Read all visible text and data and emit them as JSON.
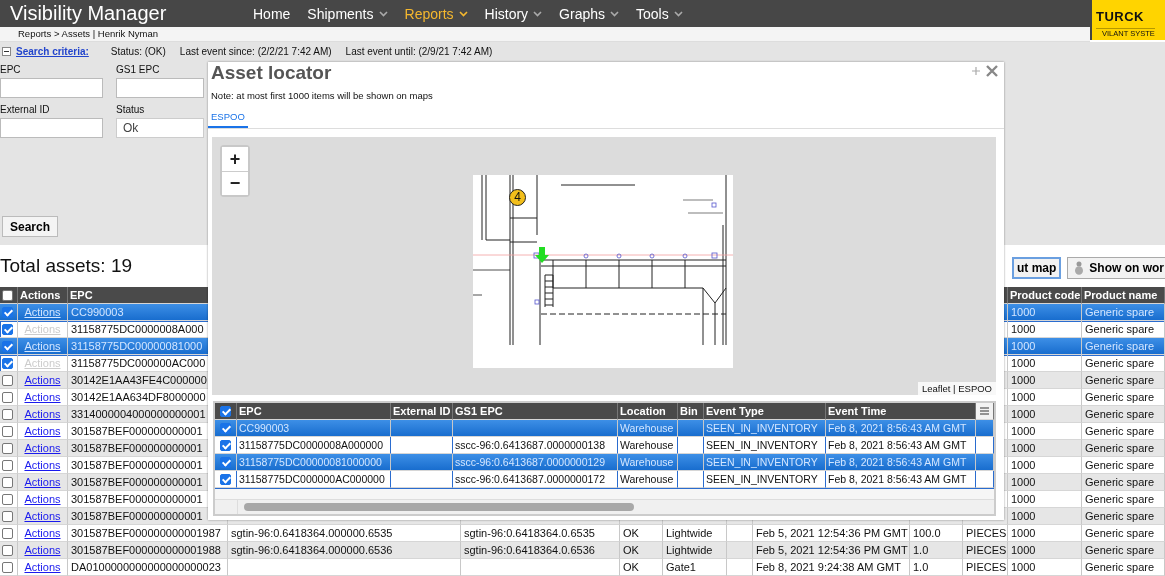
{
  "header": {
    "title": "Visibility Manager",
    "nav": [
      {
        "label": "Home",
        "selected": false,
        "has_menu": false
      },
      {
        "label": "Shipments",
        "selected": false,
        "has_menu": true
      },
      {
        "label": "Reports",
        "selected": true,
        "has_menu": true
      },
      {
        "label": "History",
        "selected": false,
        "has_menu": true
      },
      {
        "label": "Graphs",
        "selected": false,
        "has_menu": true
      },
      {
        "label": "Tools",
        "selected": false,
        "has_menu": true
      }
    ],
    "logo": {
      "brand": "TURCK",
      "tagline": "VILANT SYSTE"
    },
    "breadcrumb": "Reports > Assets | Henrik Nyman"
  },
  "search": {
    "toggle": "Search criteria:",
    "expanded": true,
    "summary": [
      "Status: (OK)",
      "Last event since: (2/2/21 7:42 AM)",
      "Last event until: (2/9/21 7:42 AM)"
    ],
    "fields": [
      {
        "label": "EPC",
        "kind": "text"
      },
      {
        "label": "GS1 EPC",
        "kind": "text"
      },
      {
        "label": "External ID",
        "kind": "text"
      },
      {
        "label": "Status",
        "kind": "select",
        "value": "Ok"
      }
    ],
    "button": "Search"
  },
  "results": {
    "total": "Total assets: 19",
    "buttons": [
      {
        "label": "ut map",
        "kind": "map"
      },
      {
        "label": "Show on wor",
        "kind": "world"
      }
    ],
    "table": {
      "header_checked": false,
      "columns": [
        "Actions",
        "EPC",
        "Product code",
        "Product name"
      ],
      "rows": [
        {
          "checked": true,
          "selected": true,
          "actions": "Actions",
          "actions_disabled": false,
          "epc": "CC990003",
          "product_code": "1000",
          "product_name": "Generic spare"
        },
        {
          "checked": true,
          "selected": false,
          "actions": "Actions",
          "actions_disabled": true,
          "epc": "31158775DC0000008A000",
          "product_code": "1000",
          "product_name": "Generic spare"
        },
        {
          "checked": true,
          "selected": true,
          "actions": "Actions",
          "actions_disabled": false,
          "epc": "31158775DC00000081000",
          "product_code": "1000",
          "product_name": "Generic spare"
        },
        {
          "checked": true,
          "selected": false,
          "actions": "Actions",
          "actions_disabled": true,
          "epc": "31158775DC000000AC000",
          "product_code": "1000",
          "product_name": "Generic spare"
        },
        {
          "checked": false,
          "selected": false,
          "actions": "Actions",
          "actions_disabled": false,
          "epc": "30142E1AA43FE4C000000",
          "product_code": "1000",
          "product_name": "Generic spare"
        },
        {
          "checked": false,
          "selected": false,
          "actions": "Actions",
          "actions_disabled": false,
          "epc": "30142E1AA634DF8000000",
          "product_code": "1000",
          "product_name": "Generic spare"
        },
        {
          "checked": false,
          "selected": false,
          "actions": "Actions",
          "actions_disabled": false,
          "epc": "3314000004000000000001",
          "product_code": "1000",
          "product_name": "Generic spare"
        },
        {
          "checked": false,
          "selected": false,
          "actions": "Actions",
          "actions_disabled": false,
          "epc": "301587BEF000000000001",
          "product_code": "1000",
          "product_name": "Generic spare"
        },
        {
          "checked": false,
          "selected": false,
          "actions": "Actions",
          "actions_disabled": false,
          "epc": "301587BEF000000000001",
          "product_code": "1000",
          "product_name": "Generic spare"
        },
        {
          "checked": false,
          "selected": false,
          "actions": "Actions",
          "actions_disabled": false,
          "epc": "301587BEF000000000001",
          "product_code": "1000",
          "product_name": "Generic spare"
        },
        {
          "checked": false,
          "selected": false,
          "actions": "Actions",
          "actions_disabled": false,
          "epc": "301587BEF000000000001",
          "product_code": "1000",
          "product_name": "Generic spare"
        },
        {
          "checked": false,
          "selected": false,
          "actions": "Actions",
          "actions_disabled": false,
          "epc": "301587BEF000000000001",
          "product_code": "1000",
          "product_name": "Generic spare"
        },
        {
          "checked": false,
          "selected": false,
          "actions": "Actions",
          "actions_disabled": false,
          "epc": "301587BEF000000000001",
          "product_code": "1000",
          "product_name": "Generic spare"
        },
        {
          "checked": false,
          "selected": false,
          "actions": "Actions",
          "actions_disabled": false,
          "epc": "301587BEF000000000001987",
          "column_4": "sgtin-96:0.6418364.000000.6535",
          "column_5": "sgtin-96:0.6418364.0.6535",
          "column_6": "OK",
          "column_7": "Lightwide",
          "column_9": "Feb 5, 2021 12:54:36 PM GMT",
          "column_10": "100.0",
          "column_11": "PIECES",
          "product_code": "1000",
          "product_name": "Generic spare"
        },
        {
          "checked": false,
          "selected": false,
          "actions": "Actions",
          "actions_disabled": false,
          "epc": "301587BEF000000000001988",
          "column_4": "sgtin-96:0.6418364.000000.6536",
          "column_5": "sgtin-96:0.6418364.0.6536",
          "column_6": "OK",
          "column_7": "Lightwide",
          "column_9": "Feb 5, 2021 12:54:36 PM GMT",
          "column_10": "1.0",
          "column_11": "PIECES",
          "product_code": "1000",
          "product_name": "Generic spare"
        },
        {
          "checked": false,
          "selected": false,
          "actions": "Actions",
          "actions_disabled": false,
          "epc": "DA0100000000000000000023",
          "column_6": "OK",
          "column_7": "Gate1",
          "column_9": "Feb 8, 2021 9:24:38 AM GMT",
          "column_10": "1.0",
          "column_11": "PIECES",
          "product_code": "1000",
          "product_name": "Generic spare"
        }
      ]
    }
  },
  "asset_locator": {
    "title": "Asset locator",
    "note": "Note: at most first 1000 items will be shown on maps",
    "tabs": [
      {
        "label": "ESPOO",
        "selected": true
      }
    ],
    "map": {
      "zoom_in": "+",
      "zoom_out": "−",
      "cluster": "4",
      "attribution": "Leaflet | ESPOO"
    },
    "table": {
      "header_checked": true,
      "columns": [
        "EPC",
        "External ID",
        "GS1 EPC",
        "Location",
        "Bin",
        "Event Type",
        "Event Time"
      ],
      "rows": [
        {
          "checked": true,
          "selected": true,
          "epc": "CC990003",
          "location": "Warehouse",
          "event_type": "SEEN_IN_INVENTORY",
          "event_time": "Feb 8, 2021 8:56:43 AM GMT"
        },
        {
          "checked": true,
          "selected": false,
          "epc": "31158775DC0000008A000000",
          "gs1_epc": "sscc-96:0.6413687.0000000138",
          "location": "Warehouse",
          "event_type": "SEEN_IN_INVENTORY",
          "event_time": "Feb 8, 2021 8:56:43 AM GMT"
        },
        {
          "checked": true,
          "selected": true,
          "epc": "31158775DC00000081000000",
          "gs1_epc": "sscc-96:0.6413687.0000000129",
          "location": "Warehouse",
          "event_type": "SEEN_IN_INVENTORY",
          "event_time": "Feb 8, 2021 8:56:43 AM GMT"
        },
        {
          "checked": true,
          "selected": false,
          "epc": "31158775DC000000AC000000",
          "gs1_epc": "sscc-96:0.6413687.0000000172",
          "location": "Warehouse",
          "event_type": "SEEN_IN_INVENTORY",
          "event_time": "Feb 8, 2021 8:56:43 AM GMT"
        }
      ]
    }
  }
}
